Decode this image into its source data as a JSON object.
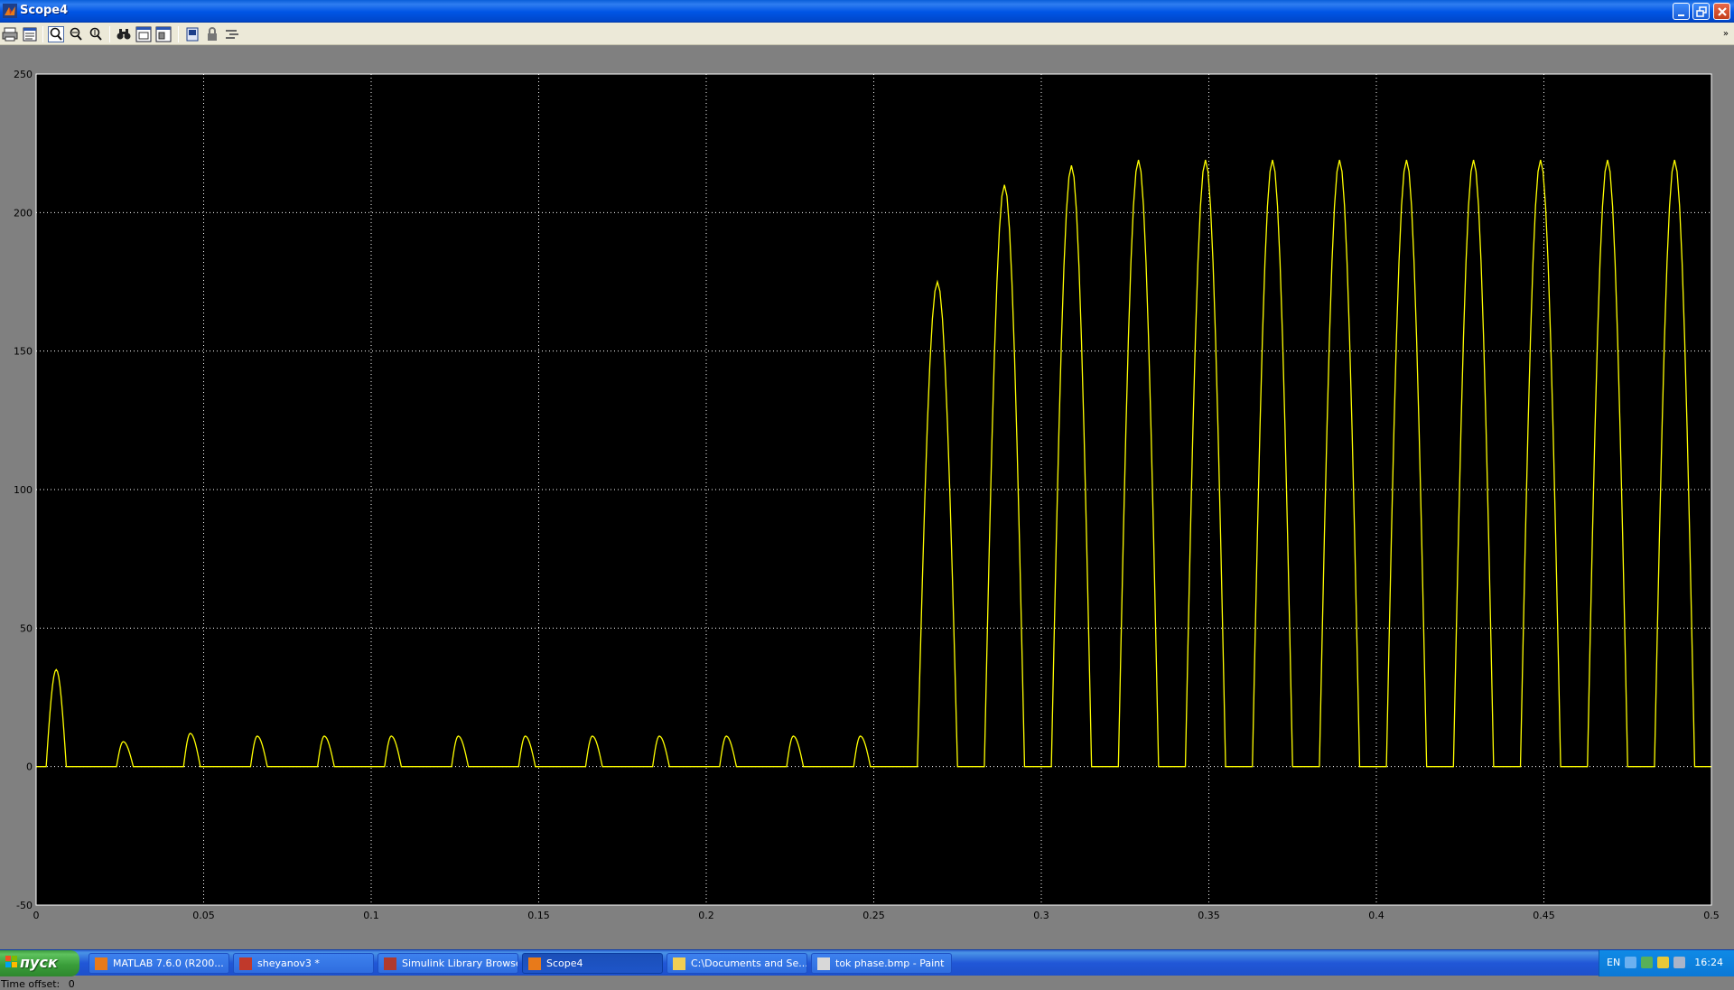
{
  "window": {
    "title": "Scope4"
  },
  "toolbar": {
    "buttons": [
      "print-icon",
      "parameters-icon",
      "zoom-icon",
      "zoom-x-icon",
      "zoom-y-icon",
      "autoscale-icon",
      "save-axes-icon",
      "restore-axes-icon",
      "floating-scope-icon",
      "lock-axes-icon",
      "signal-selection-icon"
    ]
  },
  "scope": {
    "background": "#000000",
    "trace_color": "#ffff00",
    "grid_color": "#ffffff",
    "time_offset_label": "Time offset:",
    "time_offset_value": "0"
  },
  "chart_data": {
    "type": "line",
    "title": "",
    "xlabel": "",
    "ylabel": "",
    "xlim": [
      0,
      0.5
    ],
    "ylim": [
      -50,
      250
    ],
    "grid": true,
    "x_ticks": [
      "0",
      "0.05",
      "0.1",
      "0.15",
      "0.2",
      "0.25",
      "0.3",
      "0.35",
      "0.4",
      "0.45",
      "0.5"
    ],
    "y_ticks": [
      "-50",
      "0",
      "50",
      "100",
      "150",
      "200",
      "250"
    ],
    "series": [
      {
        "color": "#ffff00",
        "pulses": [
          {
            "t_start": 0.003,
            "t_peak": 0.006,
            "t_end": 0.009,
            "peak": 35
          },
          {
            "t_start": 0.024,
            "t_peak": 0.026,
            "t_end": 0.029,
            "peak": 9
          },
          {
            "t_start": 0.044,
            "t_peak": 0.046,
            "t_end": 0.049,
            "peak": 12
          },
          {
            "t_start": 0.064,
            "t_peak": 0.066,
            "t_end": 0.069,
            "peak": 11
          },
          {
            "t_start": 0.084,
            "t_peak": 0.086,
            "t_end": 0.089,
            "peak": 11
          },
          {
            "t_start": 0.104,
            "t_peak": 0.106,
            "t_end": 0.109,
            "peak": 11
          },
          {
            "t_start": 0.124,
            "t_peak": 0.126,
            "t_end": 0.129,
            "peak": 11
          },
          {
            "t_start": 0.144,
            "t_peak": 0.146,
            "t_end": 0.149,
            "peak": 11
          },
          {
            "t_start": 0.164,
            "t_peak": 0.166,
            "t_end": 0.169,
            "peak": 11
          },
          {
            "t_start": 0.184,
            "t_peak": 0.186,
            "t_end": 0.189,
            "peak": 11
          },
          {
            "t_start": 0.204,
            "t_peak": 0.206,
            "t_end": 0.209,
            "peak": 11
          },
          {
            "t_start": 0.224,
            "t_peak": 0.226,
            "t_end": 0.229,
            "peak": 11
          },
          {
            "t_start": 0.244,
            "t_peak": 0.246,
            "t_end": 0.249,
            "peak": 11
          },
          {
            "t_start": 0.263,
            "t_peak": 0.269,
            "t_end": 0.275,
            "peak": 175
          },
          {
            "t_start": 0.283,
            "t_peak": 0.289,
            "t_end": 0.295,
            "peak": 210
          },
          {
            "t_start": 0.303,
            "t_peak": 0.309,
            "t_end": 0.315,
            "peak": 217
          },
          {
            "t_start": 0.323,
            "t_peak": 0.329,
            "t_end": 0.335,
            "peak": 219
          },
          {
            "t_start": 0.343,
            "t_peak": 0.349,
            "t_end": 0.355,
            "peak": 219
          },
          {
            "t_start": 0.363,
            "t_peak": 0.369,
            "t_end": 0.375,
            "peak": 219
          },
          {
            "t_start": 0.383,
            "t_peak": 0.389,
            "t_end": 0.395,
            "peak": 219
          },
          {
            "t_start": 0.403,
            "t_peak": 0.409,
            "t_end": 0.415,
            "peak": 219
          },
          {
            "t_start": 0.423,
            "t_peak": 0.429,
            "t_end": 0.435,
            "peak": 219
          },
          {
            "t_start": 0.443,
            "t_peak": 0.449,
            "t_end": 0.455,
            "peak": 219
          },
          {
            "t_start": 0.463,
            "t_peak": 0.469,
            "t_end": 0.475,
            "peak": 219
          },
          {
            "t_start": 0.483,
            "t_peak": 0.489,
            "t_end": 0.495,
            "peak": 219
          }
        ]
      }
    ]
  },
  "taskbar": {
    "start_label": "пуск",
    "tasks": [
      {
        "label": "MATLAB 7.6.0 (R200...",
        "icon": "matlab-icon",
        "active": false
      },
      {
        "label": "sheyanov3 *",
        "icon": "simulink-model-icon",
        "active": false
      },
      {
        "label": "Simulink Library Browser",
        "icon": "simulink-library-icon",
        "active": false
      },
      {
        "label": "Scope4",
        "icon": "matlab-icon",
        "active": true
      },
      {
        "label": "C:\\Documents and Se...",
        "icon": "folder-icon",
        "active": false
      },
      {
        "label": "tok phase.bmp - Paint",
        "icon": "paint-icon",
        "active": false
      }
    ],
    "tray": {
      "language": "EN",
      "clock": "16:24"
    }
  }
}
